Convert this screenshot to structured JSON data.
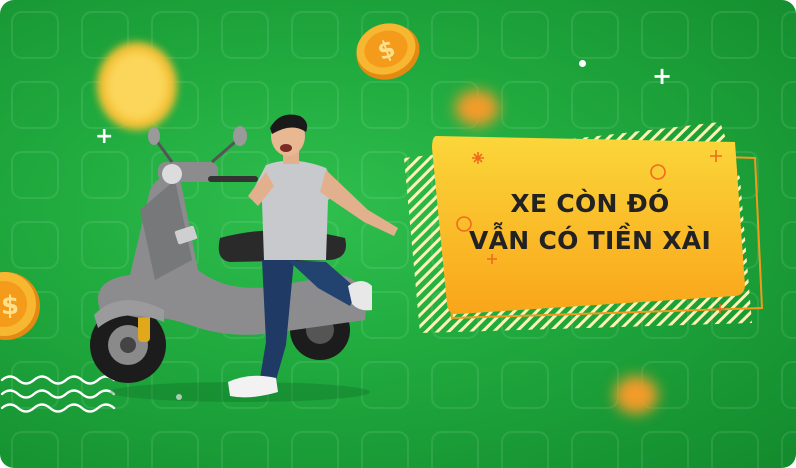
{
  "banner": {
    "headline_line1": "XE CÒN ĐÓ",
    "headline_line2": "VẪN CÓ TIỀN XÀI",
    "colors": {
      "background": "#1fa83d",
      "promo_gradient_top": "#fbd63a",
      "promo_gradient_bottom": "#f9a51a",
      "stripe": "#fff3b0",
      "coin": "#f7b731",
      "text": "#222222"
    },
    "icons": [
      "coin-icon",
      "plus-sparkle-icon",
      "scooter-illustration",
      "wave-lines-decoration"
    ]
  }
}
